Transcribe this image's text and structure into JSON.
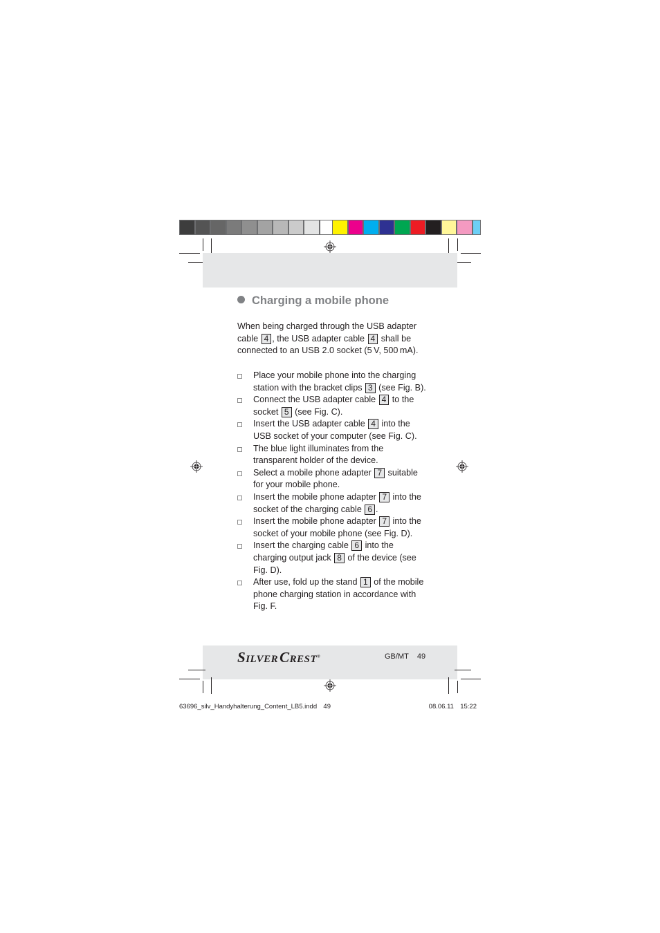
{
  "color_bar": {
    "grays": [
      "#3d3d3d",
      "#545454",
      "#666666",
      "#7b7b7b",
      "#8f8f8f",
      "#a3a3a3",
      "#b8b8b8",
      "#cbcbcb",
      "#e3e4e4",
      "#ffffff"
    ],
    "colors": [
      "#fff200",
      "#ec008c",
      "#00aeef",
      "#2e3192",
      "#00a651",
      "#ed1c24",
      "#231f20",
      "#fff799",
      "#f49ac1",
      "#6dcff6"
    ]
  },
  "section": {
    "heading": "Charging a mobile phone",
    "intro": {
      "parts": [
        "When being charged through the USB adapter cable ",
        "4",
        ", the USB adapter cable ",
        "4",
        " shall be connected to an USB 2.0 socket (5 V, 500 mA)."
      ]
    },
    "steps": [
      {
        "parts": [
          "Place your mobile phone into the charging station with the bracket clips ",
          "3",
          " (see Fig. B)."
        ]
      },
      {
        "parts": [
          "Connect the USB adapter cable ",
          "4",
          " to the socket ",
          "5",
          " (see Fig. C)."
        ]
      },
      {
        "parts": [
          "Insert the USB adapter cable ",
          "4",
          " into the USB socket of your computer (see Fig. C)."
        ]
      },
      {
        "parts": [
          "The blue light illuminates from the transparent holder of the device."
        ]
      },
      {
        "parts": [
          "Select a mobile phone adapter ",
          "7",
          " suitable for your mobile phone."
        ]
      },
      {
        "parts": [
          "Insert the mobile phone adapter ",
          "7",
          " into the socket of the charging cable ",
          "6",
          "."
        ]
      },
      {
        "parts": [
          "Insert the mobile phone adapter ",
          "7",
          " into the socket of your mobile phone (see Fig. D)."
        ]
      },
      {
        "parts": [
          "Insert the charging cable ",
          "6",
          " into the charging output jack ",
          "8",
          " of the device (see Fig. D)."
        ]
      },
      {
        "parts": [
          "After use, fold up the stand ",
          "1",
          " of the mobile phone charging station in accordance with Fig. F."
        ]
      }
    ]
  },
  "footer": {
    "brand": "SilverCrest",
    "brand_first": "S",
    "brand_mid": "ILVER",
    "brand_second": "C",
    "brand_end": "REST",
    "brand_mark": "®",
    "locale": "GB/MT",
    "page_number": "49"
  },
  "slug": {
    "filename": "63696_silv_Handyhalterung_Content_LB5.indd",
    "page": "49",
    "date": "08.06.11",
    "time": "15:22"
  }
}
